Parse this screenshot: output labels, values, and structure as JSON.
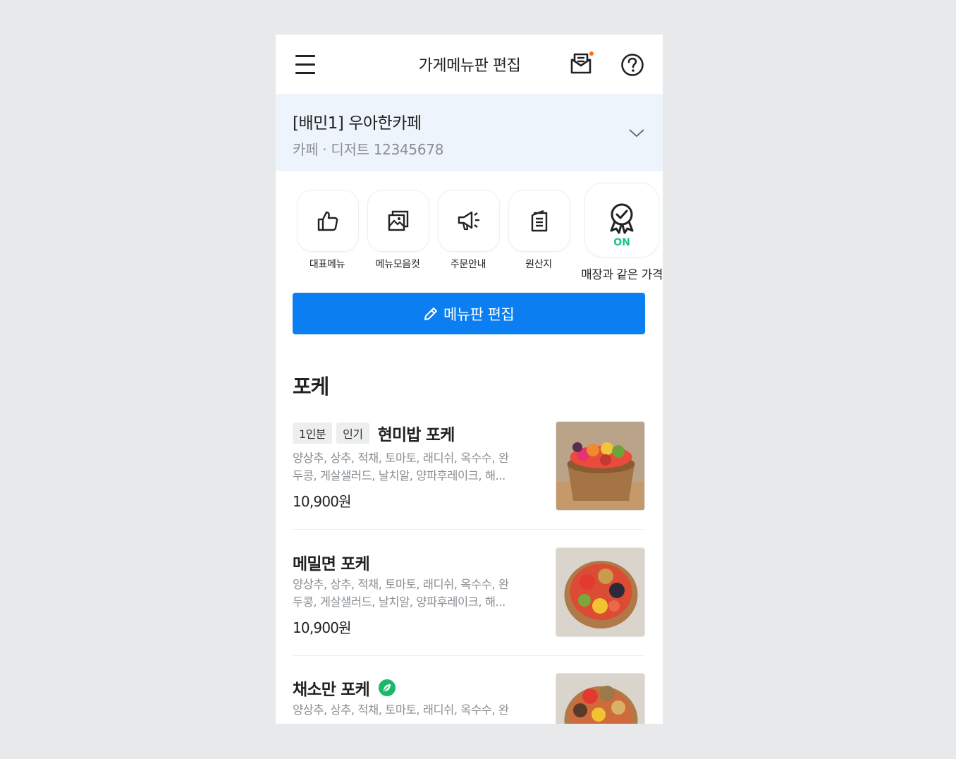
{
  "header": {
    "title": "가게메뉴판 편집",
    "menu_icon": "hamburger-icon",
    "mail_icon": "mail-icon",
    "help_icon": "help-icon",
    "notification_dot_color": "#ff6a1c"
  },
  "store": {
    "name": "[배민1] 우아한카페",
    "sub": "카페 · 디저트 12345678",
    "expand_icon": "chevron-down-icon"
  },
  "quick_actions": [
    {
      "label": "대표메뉴",
      "icon": "thumbs-up-icon"
    },
    {
      "label": "메뉴모음컷",
      "icon": "image-gallery-icon"
    },
    {
      "label": "주문안내",
      "icon": "megaphone-icon"
    },
    {
      "label": "원산지",
      "icon": "document-icon"
    },
    {
      "label": "매장과 같은 가격",
      "icon": "award-check-icon",
      "status": "ON"
    }
  ],
  "edit_button": {
    "label": "메뉴판 편집",
    "icon": "pencil-icon",
    "color": "#0b7ff2"
  },
  "section": {
    "title": "포케"
  },
  "items": [
    {
      "tags": [
        "1인분",
        "인기"
      ],
      "name": "현미밥 포케",
      "desc_line1": "양상추, 상추, 적채, 토마토, 래디쉬, 옥수수, 완",
      "desc_line2": "두콩, 게살샐러드, 날치알, 양파후레이크, 해...",
      "price": "10,900원"
    },
    {
      "name": "메밀면 포케",
      "desc_line1": "양상추, 상추, 적채, 토마토, 래디쉬, 옥수수, 완",
      "desc_line2": "두콩, 게살샐러드, 날치알, 양파후레이크, 해...",
      "price": "10,900원"
    },
    {
      "name": "채소만 포케",
      "badge_icon": "vegan-leaf-icon",
      "desc_line1": "양상추, 상추, 적채, 토마토, 래디쉬, 옥수수, 완"
    }
  ],
  "colors": {
    "highlight": "#2ebcb4",
    "on_status": "#1cc38e",
    "accent": "#0b7ff2"
  }
}
